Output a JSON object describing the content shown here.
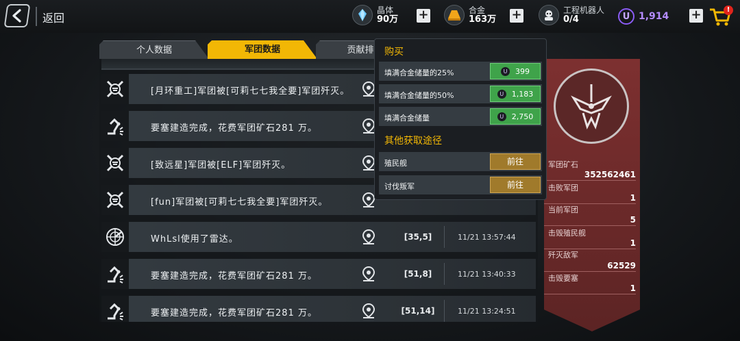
{
  "header": {
    "back_label": "返回",
    "resources": [
      {
        "name": "晶体",
        "value": "90万",
        "icon": "crystal-icon"
      },
      {
        "name": "合金",
        "value": "163万",
        "icon": "alloy-icon"
      },
      {
        "name": "工程机器人",
        "value": "0/4",
        "icon": "robot-icon"
      }
    ],
    "premium_value": "1,914",
    "premium_symbol": "U",
    "cart_badge": "!"
  },
  "tabs": [
    {
      "label": "个人数据"
    },
    {
      "label": "军团数据"
    },
    {
      "label": "贡献排"
    }
  ],
  "events": [
    {
      "icon": "crossed-swords-icon",
      "message": "[月环重工]军团被[可莉七七我全要]军团歼灭。",
      "coord": "",
      "time": ""
    },
    {
      "icon": "robot-arm-icon",
      "message": "要塞建造完成，花费军团矿石281 万。",
      "coord": "",
      "time": ""
    },
    {
      "icon": "crossed-swords-icon",
      "message": "[致远星]军团被[ELF]军团歼灭。",
      "coord": "",
      "time": ""
    },
    {
      "icon": "crossed-swords-icon",
      "message": "[fun]军团被[可莉七七我全要]军团歼灭。",
      "coord": "",
      "time": ""
    },
    {
      "icon": "radar-icon",
      "message": "WhLsl使用了雷达。",
      "coord": "[35,5]",
      "time": "11/21 13:57:44"
    },
    {
      "icon": "robot-arm-icon",
      "message": "要塞建造完成，花费军团矿石281 万。",
      "coord": "[51,8]",
      "time": "11/21 13:40:33"
    },
    {
      "icon": "robot-arm-icon",
      "message": "要塞建造完成，花费军团矿石281 万。",
      "coord": "[51,14]",
      "time": "11/21 13:24:51"
    }
  ],
  "stats": [
    {
      "label": "军团矿石",
      "value": "352562461"
    },
    {
      "label": "击败军团",
      "value": "1"
    },
    {
      "label": "当前军团",
      "value": "5"
    },
    {
      "label": "击毁殖民舰",
      "value": "1"
    },
    {
      "label": "歼灭敌军",
      "value": "62529"
    },
    {
      "label": "击毁要塞",
      "value": "1"
    }
  ],
  "popup": {
    "buy_title": "购买",
    "buy_options": [
      {
        "label": "填满合金储量的25%",
        "price": "399"
      },
      {
        "label": "填满合金储量的50%",
        "price": "1,183"
      },
      {
        "label": "填满合金储量",
        "price": "2,750"
      }
    ],
    "other_title": "其他获取途径",
    "other_options": [
      {
        "label": "殖民舰",
        "action": "前往"
      },
      {
        "label": "讨伐叛军",
        "action": "前往"
      }
    ],
    "coin_symbol": "U"
  },
  "colors": {
    "accent": "#f2b705",
    "buy_green": "#3fa34a",
    "go_gold": "#a07a2b",
    "stats_red": "#7d3030",
    "premium_purple": "#8b5cf6"
  }
}
